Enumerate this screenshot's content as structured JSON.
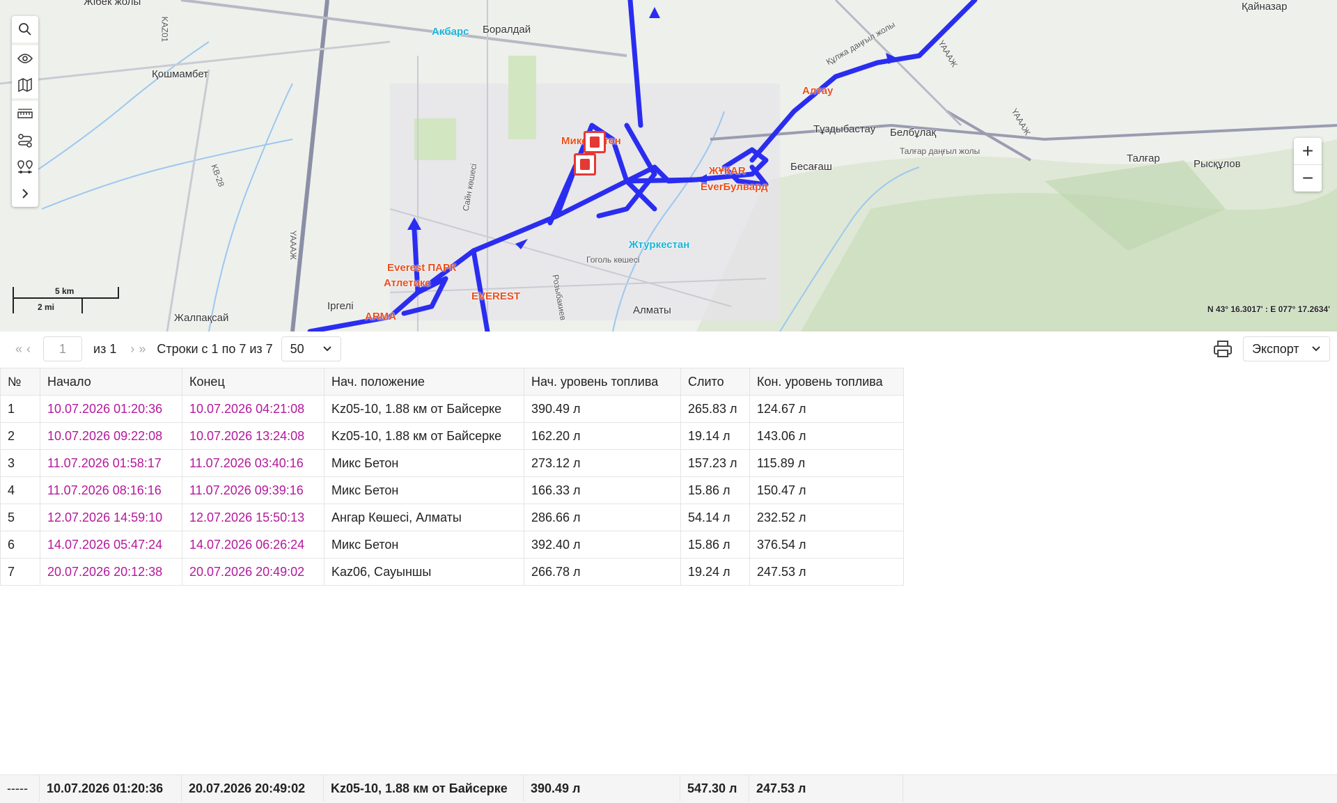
{
  "map": {
    "labels": {
      "akbars": "Акбарс",
      "boraldai": "Боралдай",
      "koshmambet": "Қошмамбет",
      "zhibek": "Жібек жолы",
      "kainazar": "Қайназар",
      "altay": "Алтау",
      "tuzdybastau": "Тұздыбастау",
      "belbulak": "Белбұлақ",
      "talgar_road": "Талғар даңғыл жолы",
      "talgar": "Талғар",
      "ryskulov": "Рысқұлов",
      "besagash": "Бесағаш",
      "mix_beton": "Микс Бетон",
      "zhukar": "ЖҰКАR",
      "everbulvard": "EverБулвард",
      "turkestan": "Жтуркестан",
      "everest_park": "Everest ПАРК",
      "atle": "Атлетикс",
      "everest": "EVEREST",
      "arma": "ARMA",
      "irgeli": "Іргелі",
      "zhalpaksai": "Жалпақсай",
      "almaty": "Алматы",
      "gogol": "Гоголь көшесі",
      "sain": "Сайн көшесі",
      "kulzha": "Құлжа даңғыл жолы",
      "rozybakiev": "Розыбакиев",
      "kaz01": "KAZ01",
      "kb28": "KB-28",
      "ya1": "YAAAЖ",
      "ya2": "YAAAЖ",
      "ya3": "YAAAЖ"
    },
    "scale": {
      "km": "5 km",
      "mi": "2 mi"
    },
    "coords": "N 43° 16.3017' : E 077° 17.2634'",
    "zoom_in": "+",
    "zoom_out": "−"
  },
  "pager": {
    "page": "1",
    "of": "из 1",
    "rows": "Строки с 1 по 7 из 7",
    "page_size": "50",
    "export": "Экспорт"
  },
  "table": {
    "columns": [
      "№",
      "Начало",
      "Конец",
      "Нач. положение",
      "Нач. уровень топлива",
      "Слито",
      "Кон. уровень топлива"
    ],
    "rows": [
      [
        "1",
        "10.07.2026 01:20:36",
        "10.07.2026 04:21:08",
        "Kz05-10, 1.88 км от Байсерке",
        "390.49 л",
        "265.83 л",
        "124.67 л"
      ],
      [
        "2",
        "10.07.2026 09:22:08",
        "10.07.2026 13:24:08",
        "Kz05-10, 1.88 км от Байсерке",
        "162.20 л",
        "19.14 л",
        "143.06 л"
      ],
      [
        "3",
        "11.07.2026 01:58:17",
        "11.07.2026 03:40:16",
        "Микс Бетон",
        "273.12 л",
        "157.23 л",
        "115.89 л"
      ],
      [
        "4",
        "11.07.2026 08:16:16",
        "11.07.2026 09:39:16",
        "Микс Бетон",
        "166.33 л",
        "15.86 л",
        "150.47 л"
      ],
      [
        "5",
        "12.07.2026 14:59:10",
        "12.07.2026 15:50:13",
        "Ангар Көшесі, Алматы",
        "286.66 л",
        "54.14 л",
        "232.52 л"
      ],
      [
        "6",
        "14.07.2026 05:47:24",
        "14.07.2026 06:26:24",
        "Микс Бетон",
        "392.40 л",
        "15.86 л",
        "376.54 л"
      ],
      [
        "7",
        "20.07.2026 20:12:38",
        "20.07.2026 20:49:02",
        "Kaz06, Сауыншы",
        "266.78 л",
        "19.24 л",
        "247.53 л"
      ]
    ],
    "footer": [
      "-----",
      "10.07.2026 01:20:36",
      "20.07.2026 20:49:02",
      "Kz05-10, 1.88 км от Байсерке",
      "390.49 л",
      "547.30 л",
      "247.53 л"
    ]
  },
  "colors": {
    "route": "#2a2df0",
    "date": "#b3199b",
    "poi": "#e8501b"
  }
}
